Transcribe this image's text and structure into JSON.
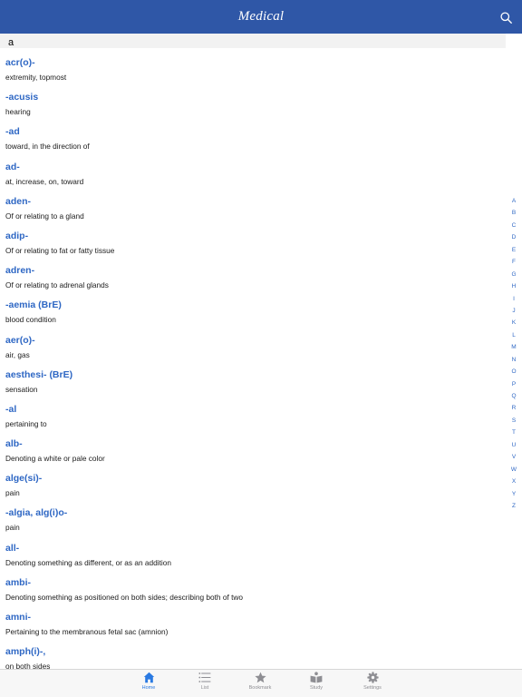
{
  "header": {
    "title": "Medical",
    "bg_color": "#2f57a7"
  },
  "search": {
    "value": "a"
  },
  "entries": [
    {
      "term": "acr(o)-",
      "meaning": "extremity, topmost"
    },
    {
      "term": "-acusis",
      "meaning": "hearing"
    },
    {
      "term": "-ad",
      "meaning": "toward, in the direction of"
    },
    {
      "term": "ad-",
      "meaning": "at, increase, on, toward"
    },
    {
      "term": "aden-",
      "meaning": "Of or relating to a gland"
    },
    {
      "term": "adip-",
      "meaning": "Of or relating to fat or fatty tissue"
    },
    {
      "term": "adren-",
      "meaning": "Of or relating to adrenal glands"
    },
    {
      "term": "-aemia (BrE)",
      "meaning": "blood condition"
    },
    {
      "term": "aer(o)-",
      "meaning": "air, gas"
    },
    {
      "term": "aesthesi- (BrE)",
      "meaning": "sensation"
    },
    {
      "term": "-al",
      "meaning": "pertaining to"
    },
    {
      "term": "alb-",
      "meaning": "Denoting a white or pale color"
    },
    {
      "term": "alge(si)-",
      "meaning": "pain"
    },
    {
      "term": "-algia, alg(i)o-",
      "meaning": "pain"
    },
    {
      "term": "all-",
      "meaning": "Denoting something as different, or as an addition"
    },
    {
      "term": "ambi-",
      "meaning": "Denoting something as positioned on both sides; describing both of two"
    },
    {
      "term": "amni-",
      "meaning": "Pertaining to the membranous fetal sac (amnion)"
    },
    {
      "term": "amph(i)-,",
      "meaning": "on both sides"
    }
  ],
  "index_letters": [
    "A",
    "B",
    "C",
    "D",
    "E",
    "F",
    "G",
    "H",
    "I",
    "J",
    "K",
    "L",
    "M",
    "N",
    "O",
    "P",
    "Q",
    "R",
    "S",
    "T",
    "U",
    "V",
    "W",
    "X",
    "Y",
    "Z"
  ],
  "tabs": [
    {
      "label": "Home",
      "icon": "home-icon",
      "active": true
    },
    {
      "label": "List",
      "icon": "list-icon",
      "active": false
    },
    {
      "label": "Bookmark",
      "icon": "star-icon",
      "active": false
    },
    {
      "label": "Study",
      "icon": "book-icon",
      "active": false
    },
    {
      "label": "Settings",
      "icon": "gear-icon",
      "active": false
    }
  ],
  "colors": {
    "accent": "#2e67c4",
    "tab_active": "#2a7ae2",
    "tab_inactive": "#8e8e93"
  }
}
